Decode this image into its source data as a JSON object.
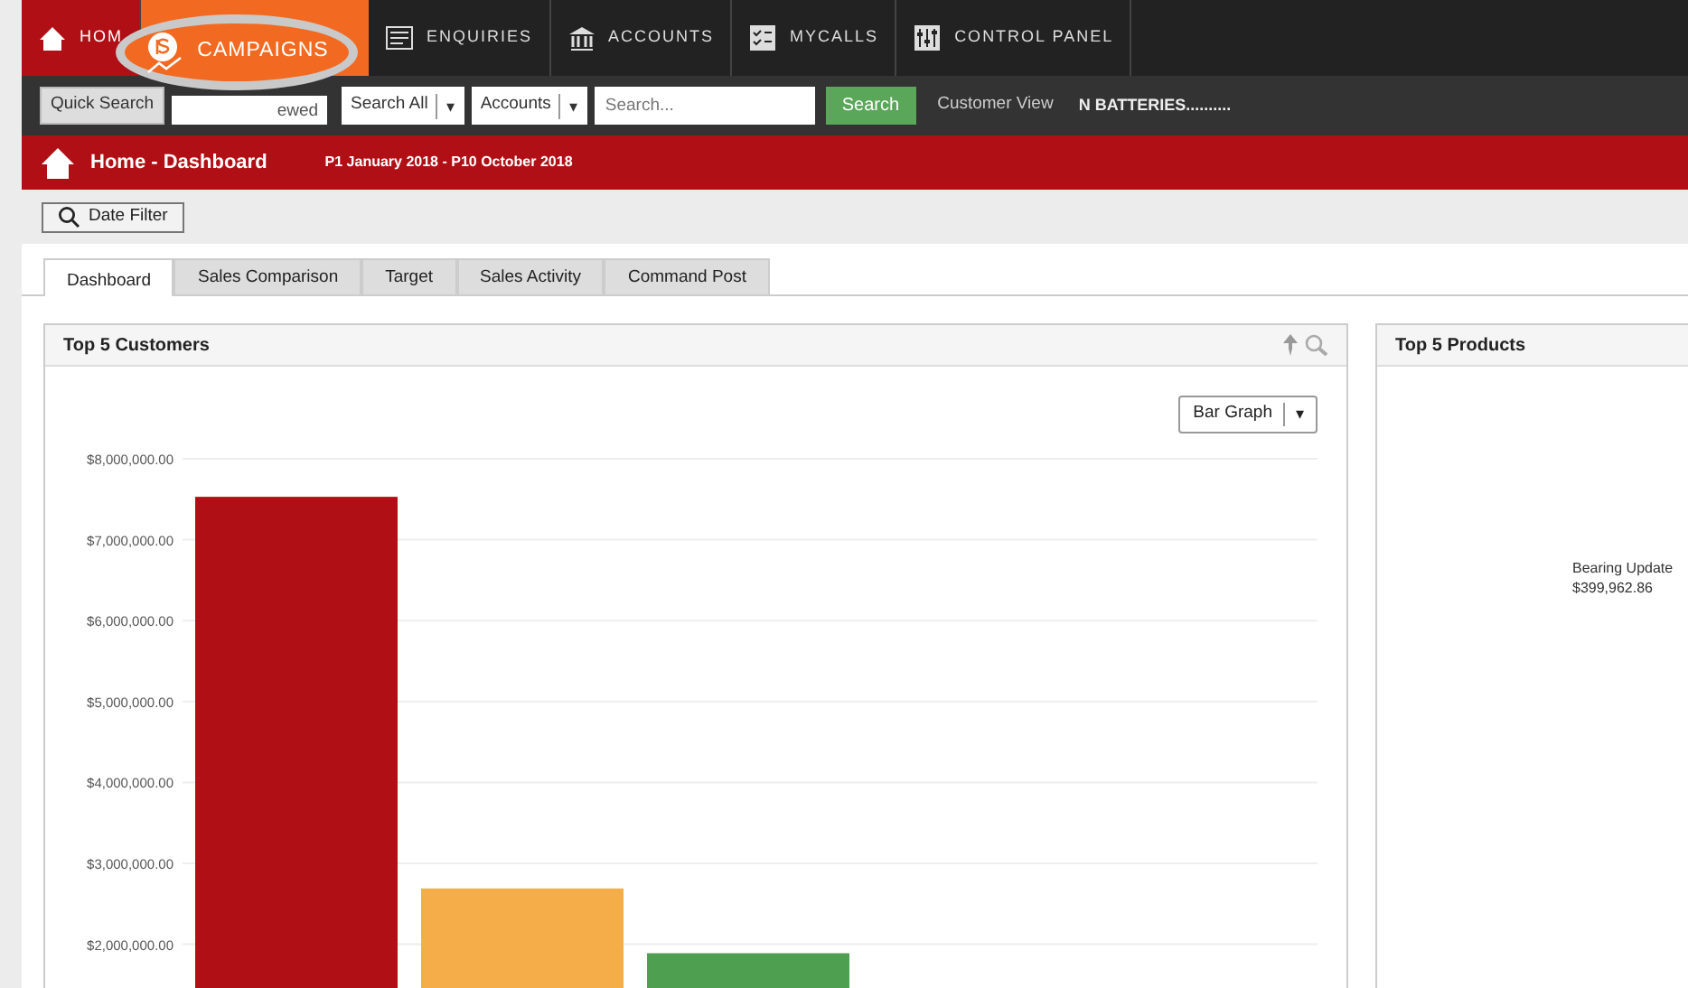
{
  "top_nav": [
    {
      "label": "HOM",
      "selected": true
    },
    {
      "label": "ENQUIRIES",
      "selected": false
    },
    {
      "label": "ACCOUNTS",
      "selected": false
    },
    {
      "label": "MYCALLS",
      "selected": false
    },
    {
      "label": "CONTROL PANEL",
      "selected": false
    }
  ],
  "callout": {
    "label": "CAMPAIGNS"
  },
  "search_bar": {
    "quick_search": "Quick Search",
    "recent_field": "ewed",
    "scope_select": "Search All",
    "scope_arrow": "▾",
    "type_select": "Accounts",
    "type_arrow": "▾",
    "placeholder": "Search...",
    "search_button": "Search",
    "customer_view": "Customer View",
    "customer_name": "N BATTERIES.........."
  },
  "breadcrumb": {
    "title": "Home - Dashboard",
    "period": "P1 January 2018 - P10 October 2018"
  },
  "date_filter": "Date Filter",
  "tabs": [
    {
      "label": "Dashboard",
      "selected": true
    },
    {
      "label": "Sales Comparison",
      "selected": false
    },
    {
      "label": "Target",
      "selected": false
    },
    {
      "label": "Sales Activity",
      "selected": false
    },
    {
      "label": "Command Post",
      "selected": false
    }
  ],
  "customers_panel": {
    "title": "Top 5 Customers",
    "view_select": "Bar Graph",
    "view_arrow": "▾",
    "chart_data": {
      "type": "bar",
      "grid": true,
      "ylim": [
        1460000,
        8000000
      ],
      "yticks": [
        {
          "value": 2000000,
          "label": "$2,000,000.00"
        },
        {
          "value": 3000000,
          "label": "$3,000,000.00"
        },
        {
          "value": 4000000,
          "label": "$4,000,000.00"
        },
        {
          "value": 5000000,
          "label": "$5,000,000.00"
        },
        {
          "value": 6000000,
          "label": "$6,000,000.00"
        },
        {
          "value": 7000000,
          "label": "$7,000,000.00"
        },
        {
          "value": 8000000,
          "label": "$8,000,000.00"
        }
      ],
      "values": [
        7530000,
        2690000,
        1890000
      ],
      "colors": [
        "#b01015",
        "#f4ad48",
        "#4e9f50"
      ]
    }
  },
  "products_panel": {
    "title": "Top 5 Products",
    "label": "Bearing Update",
    "value": "$399,962.86"
  }
}
